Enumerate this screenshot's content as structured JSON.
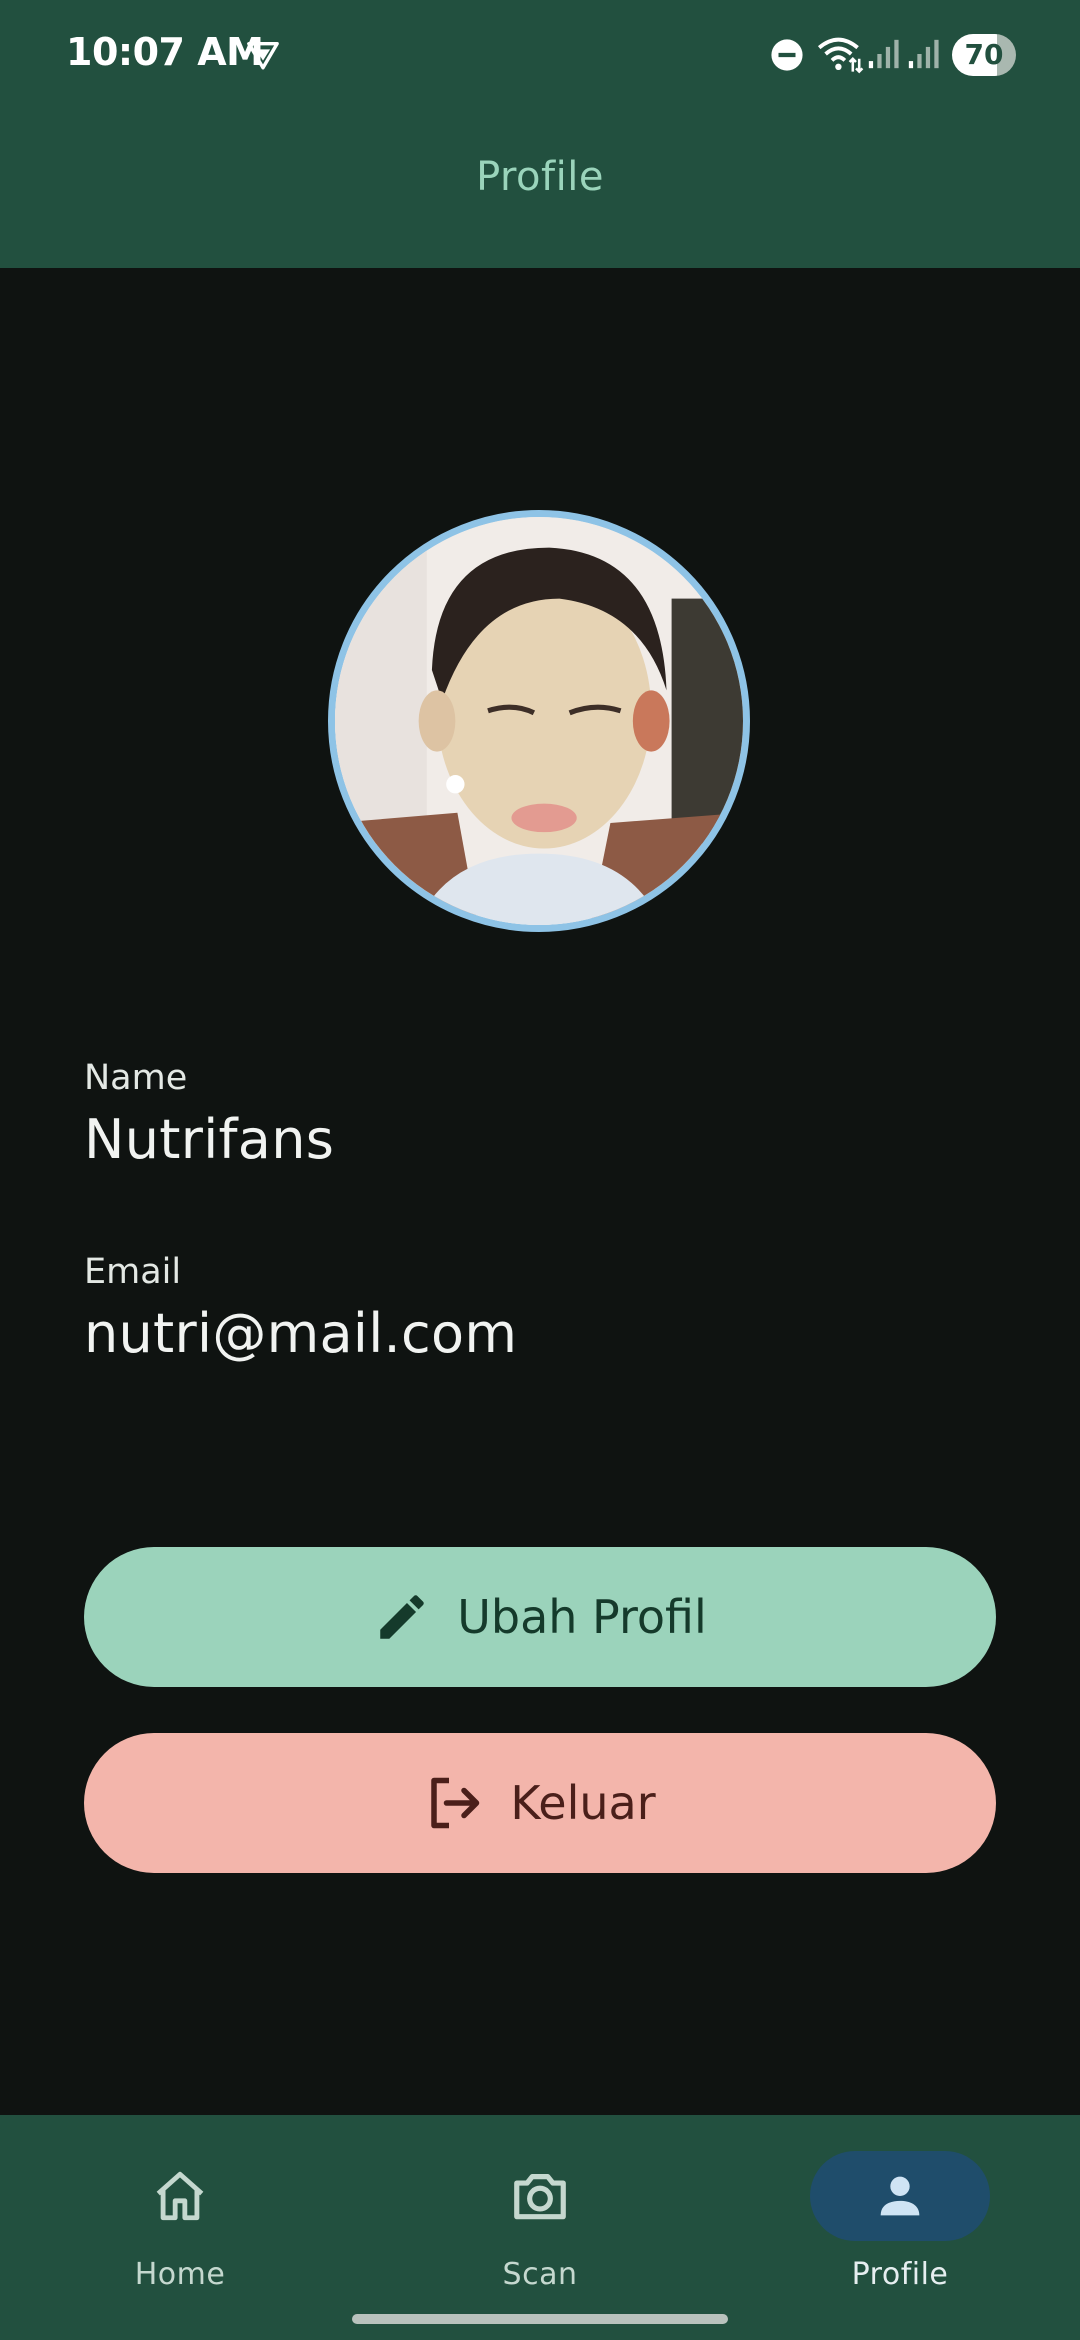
{
  "status_bar": {
    "time": "10:07 AM",
    "battery": "70",
    "icons": [
      "vpn-icon",
      "do-not-disturb-icon",
      "wifi-icon",
      "signal-icon",
      "signal-icon"
    ]
  },
  "app_bar": {
    "title": "Profile"
  },
  "profile": {
    "name_label": "Name",
    "name": "Nutrifans",
    "email_label": "Email",
    "email": "nutri@mail.com"
  },
  "actions": {
    "edit_label": "Ubah Profil",
    "edit_icon": "pencil-icon",
    "logout_label": "Keluar",
    "logout_icon": "logout-icon"
  },
  "bottom_nav": {
    "items": [
      {
        "label": "Home",
        "icon": "home-icon",
        "active": false
      },
      {
        "label": "Scan",
        "icon": "camera-icon",
        "active": false
      },
      {
        "label": "Profile",
        "icon": "person-icon",
        "active": true
      }
    ]
  },
  "colors": {
    "bar": "#22503f",
    "background": "#0f1311",
    "title": "#9ad4bb",
    "edit_button": "#9bd3bb",
    "logout_button": "#f3b5ab",
    "avatar_ring": "#8ec3e6",
    "active_nav_pill": "#1f4d6b"
  }
}
